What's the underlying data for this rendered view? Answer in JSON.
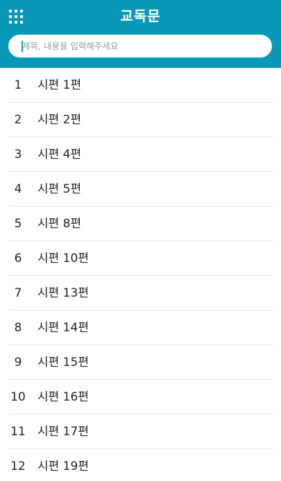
{
  "header": {
    "title": "교독문",
    "menu_icon": "grid-menu-icon",
    "background_color": "#0a98b8"
  },
  "search": {
    "placeholder": "제목, 내용을 입력해주세요",
    "value": ""
  },
  "items": [
    {
      "number": "1",
      "title": "시편 1편"
    },
    {
      "number": "2",
      "title": "시편 2편"
    },
    {
      "number": "3",
      "title": "시편 4편"
    },
    {
      "number": "4",
      "title": "시편 5편"
    },
    {
      "number": "5",
      "title": "시편 8편"
    },
    {
      "number": "6",
      "title": "시편 10편"
    },
    {
      "number": "7",
      "title": "시편 13편"
    },
    {
      "number": "8",
      "title": "시편 14편"
    },
    {
      "number": "9",
      "title": "시편 15편"
    },
    {
      "number": "10",
      "title": "시편 16편"
    },
    {
      "number": "11",
      "title": "시편 17편"
    },
    {
      "number": "12",
      "title": "시편 19편"
    }
  ]
}
